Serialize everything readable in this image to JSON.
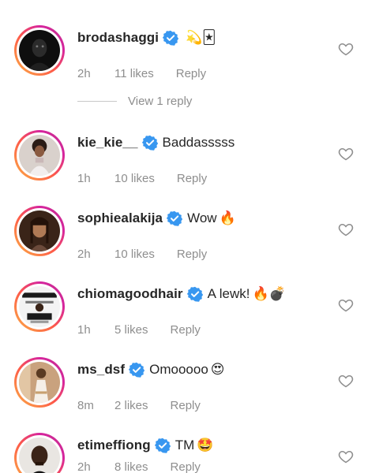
{
  "comments": [
    {
      "username": "brodashaggi",
      "verified": true,
      "text": "",
      "emoji": "💫🃏",
      "time": "2h",
      "likes": "11 likes",
      "reply": "Reply",
      "icon": "heart-outline-icon"
    },
    {
      "username": "kie_kie__",
      "verified": true,
      "text": "Baddasssss",
      "emoji": "",
      "time": "1h",
      "likes": "10 likes",
      "reply": "Reply",
      "icon": "heart-outline-icon"
    },
    {
      "username": "sophiealakija",
      "verified": true,
      "text": "Wow",
      "emoji": "🔥",
      "time": "2h",
      "likes": "10 likes",
      "reply": "Reply",
      "icon": "heart-outline-icon"
    },
    {
      "username": "chiomagoodhair",
      "verified": true,
      "text": "A lewk!",
      "emoji": "🔥💣",
      "time": "1h",
      "likes": "5 likes",
      "reply": "Reply",
      "icon": "heart-outline-icon"
    },
    {
      "username": "ms_dsf",
      "verified": true,
      "text": "Omooooo",
      "emoji": "😍",
      "time": "8m",
      "likes": "2 likes",
      "reply": "Reply",
      "icon": "heart-outline-icon"
    },
    {
      "username": "etimeffiong",
      "verified": true,
      "text": "TM",
      "emoji": "🤩",
      "time": "2h",
      "likes": "8 likes",
      "reply": "Reply",
      "icon": "heart-outline-icon"
    }
  ],
  "view_replies": {
    "label": "View 1 reply"
  },
  "colors": {
    "verified_blue": "#3897f0",
    "meta_gray": "#8e8e8e",
    "text_dark": "#262626"
  }
}
